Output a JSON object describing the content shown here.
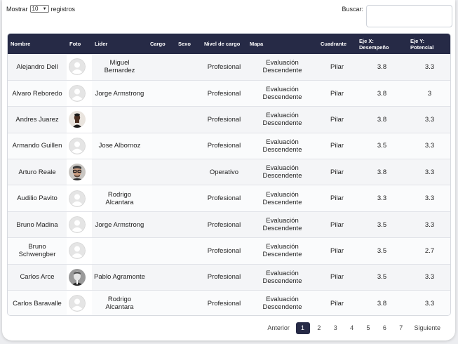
{
  "length_menu": {
    "prefix": "Mostrar",
    "value": "10",
    "suffix": "registros"
  },
  "search": {
    "label": "Buscar:",
    "value": ""
  },
  "columns": [
    "Nombre",
    "Foto",
    "Lider",
    "Cargo",
    "Sexo",
    "Nivel de cargo",
    "Mapa",
    "Cuadrante",
    "Eje X: Desempeño",
    "Eje Y: Potencial"
  ],
  "rows": [
    {
      "nombre": "Alejandro Dell",
      "foto": "default",
      "lider": "Miguel Bernardez",
      "cargo": "",
      "sexo": "",
      "nivel": "Profesional",
      "mapa": "Evaluación Descendente",
      "cuadrante": "Pilar",
      "x": "3.8",
      "y": "3.3"
    },
    {
      "nombre": "Alvaro Reboredo",
      "foto": "default",
      "lider": "Jorge Armstrong",
      "cargo": "",
      "sexo": "",
      "nivel": "Profesional",
      "mapa": "Evaluación Descendente",
      "cuadrante": "Pilar",
      "x": "3.8",
      "y": "3"
    },
    {
      "nombre": "Andres Juarez",
      "foto": "photo-dark",
      "lider": "",
      "cargo": "",
      "sexo": "",
      "nivel": "Profesional",
      "mapa": "Evaluación Descendente",
      "cuadrante": "Pilar",
      "x": "3.8",
      "y": "3.3"
    },
    {
      "nombre": "Armando Guillen",
      "foto": "default",
      "lider": "Jose Albornoz",
      "cargo": "",
      "sexo": "",
      "nivel": "Profesional",
      "mapa": "Evaluación Descendente",
      "cuadrante": "Pilar",
      "x": "3.5",
      "y": "3.3"
    },
    {
      "nombre": "Arturo Reale",
      "foto": "photo-glasses",
      "lider": "",
      "cargo": "",
      "sexo": "",
      "nivel": "Operativo",
      "mapa": "Evaluación Descendente",
      "cuadrante": "Pilar",
      "x": "3.8",
      "y": "3.3"
    },
    {
      "nombre": "Audilio Pavito",
      "foto": "default",
      "lider": "Rodrigo Alcantara",
      "cargo": "",
      "sexo": "",
      "nivel": "Profesional",
      "mapa": "Evaluación Descendente",
      "cuadrante": "Pilar",
      "x": "3.3",
      "y": "3.3"
    },
    {
      "nombre": "Bruno Madina",
      "foto": "default",
      "lider": "Jorge Armstrong",
      "cargo": "",
      "sexo": "",
      "nivel": "Profesional",
      "mapa": "Evaluación Descendente",
      "cuadrante": "Pilar",
      "x": "3.5",
      "y": "3.3"
    },
    {
      "nombre": "Bruno Schwengber",
      "foto": "default",
      "lider": "",
      "cargo": "",
      "sexo": "",
      "nivel": "Profesional",
      "mapa": "Evaluación Descendente",
      "cuadrante": "Pilar",
      "x": "3.5",
      "y": "2.7"
    },
    {
      "nombre": "Carlos Arce",
      "foto": "photo-gray",
      "lider": "Pablo Agramonte",
      "cargo": "",
      "sexo": "",
      "nivel": "Profesional",
      "mapa": "Evaluación Descendente",
      "cuadrante": "Pilar",
      "x": "3.5",
      "y": "3.3"
    },
    {
      "nombre": "Carlos Baravalle",
      "foto": "default",
      "lider": "Rodrigo Alcantara",
      "cargo": "",
      "sexo": "",
      "nivel": "Profesional",
      "mapa": "Evaluación Descendente",
      "cuadrante": "Pilar",
      "x": "3.8",
      "y": "3.3"
    }
  ],
  "pagination": {
    "prev": "Anterior",
    "next": "Siguiente",
    "pages": [
      "1",
      "2",
      "3",
      "4",
      "5",
      "6",
      "7"
    ],
    "current": "1"
  },
  "colors": {
    "header_bg": "#262a46",
    "active_page": "#262a46"
  }
}
